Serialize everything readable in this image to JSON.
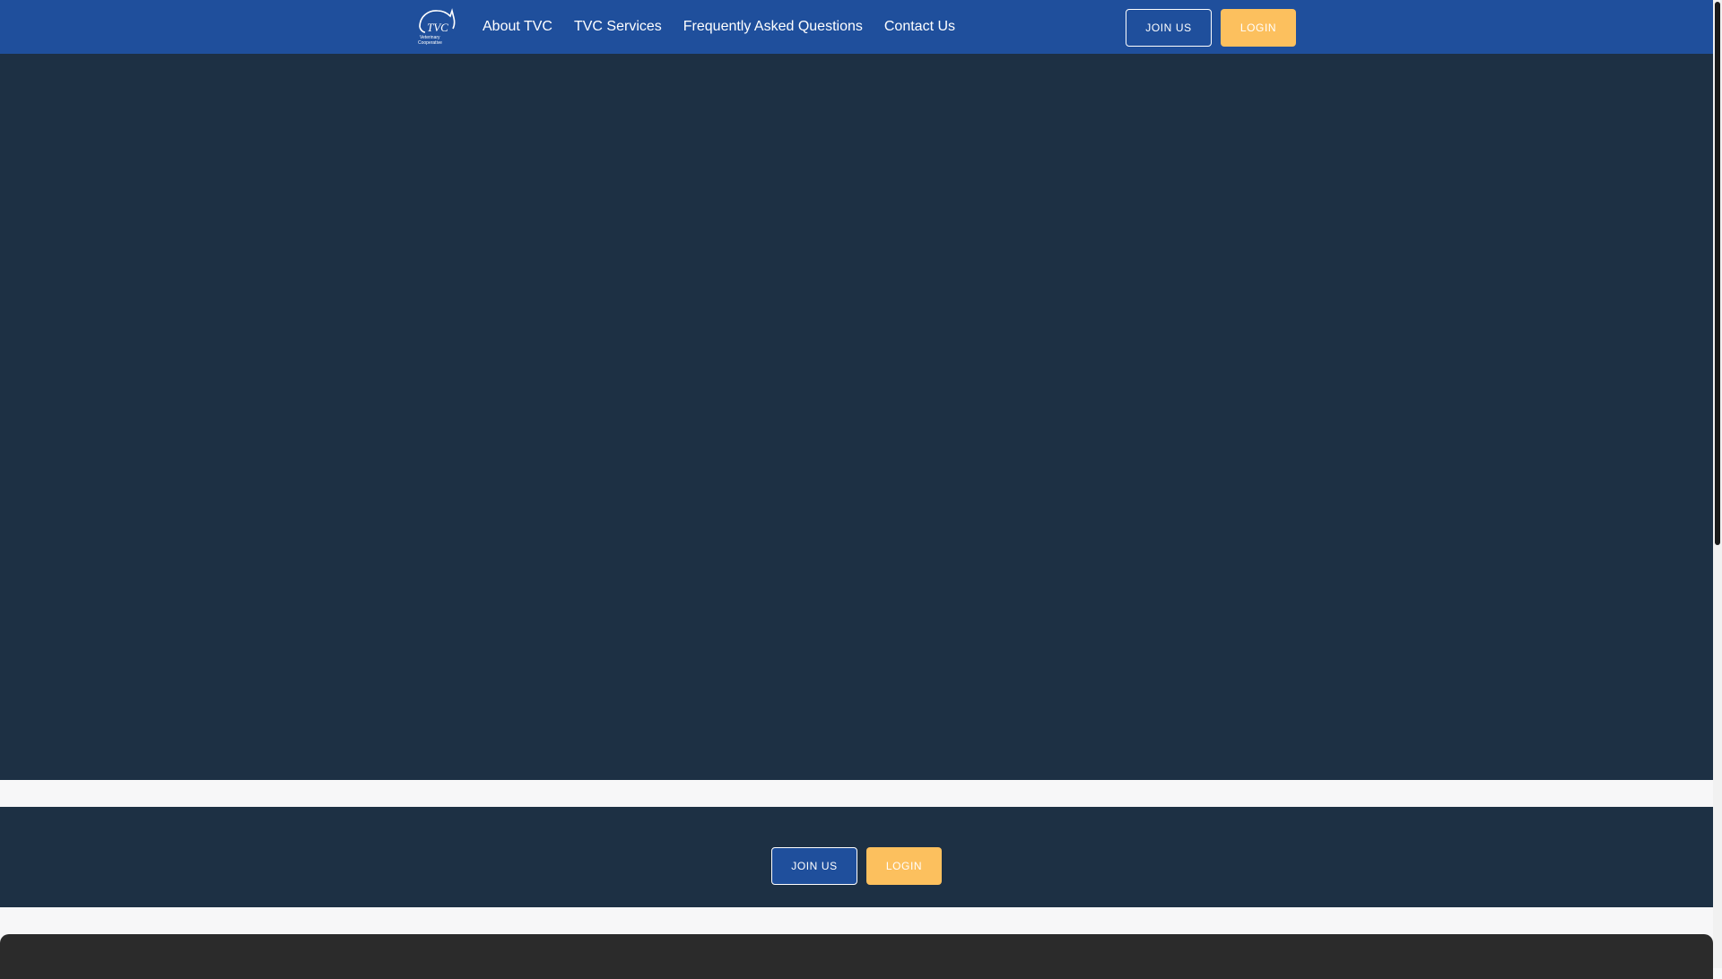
{
  "navbar": {
    "logo": {
      "icon": "tvc-cat-logo-icon",
      "text": "TVC",
      "subtext": "Veterinary Cooperative"
    },
    "links": [
      {
        "label": "About TVC"
      },
      {
        "label": "TVC Services"
      },
      {
        "label": "Frequently Asked Questions"
      },
      {
        "label": "Contact Us"
      }
    ],
    "join_label": "JOIN US",
    "login_label": "LOGIN"
  },
  "cta": {
    "join_label": "JOIN US",
    "login_label": "LOGIN"
  },
  "colors": {
    "navbar": "#1f4f9c",
    "hero": "#1d3044",
    "accent": "#fcc05e",
    "footer": "#2b2b2b"
  }
}
